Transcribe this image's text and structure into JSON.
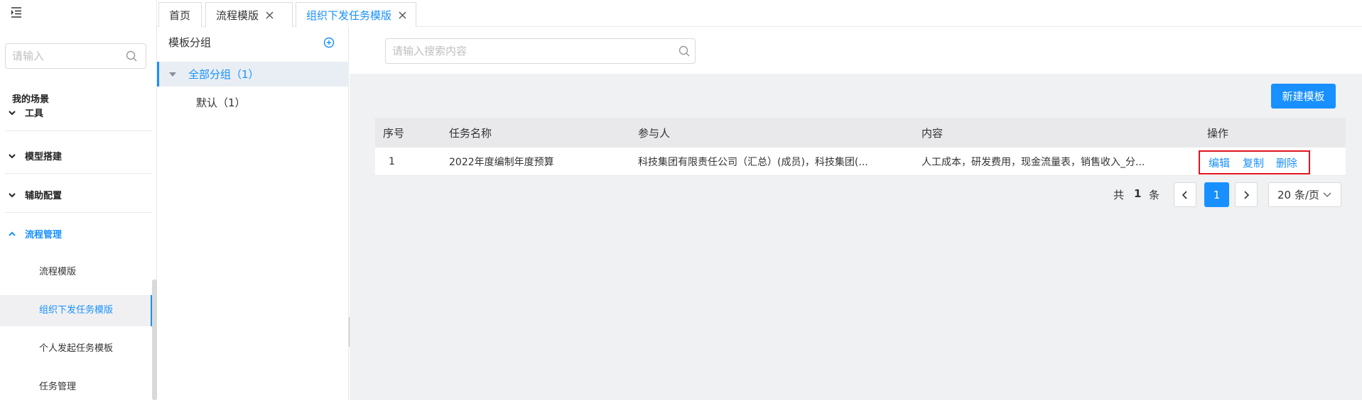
{
  "nav": {
    "search_placeholder": "请输入",
    "section_title": "我的场景",
    "groups": [
      {
        "label": "工具",
        "expanded": false
      },
      {
        "label": "模型搭建",
        "expanded": false
      },
      {
        "label": "辅助配置",
        "expanded": false
      },
      {
        "label": "流程管理",
        "expanded": true
      }
    ],
    "sub_items": [
      {
        "label": "流程模版",
        "active": false
      },
      {
        "label": "组织下发任务模版",
        "active": true
      },
      {
        "label": "个人发起任务模板",
        "active": false
      },
      {
        "label": "任务管理",
        "active": false
      }
    ]
  },
  "tabs": [
    {
      "label": "首页",
      "closable": false,
      "active": false
    },
    {
      "label": "流程模版",
      "closable": true,
      "active": false
    },
    {
      "label": "组织下发任务模版",
      "closable": true,
      "active": true
    }
  ],
  "template_groups": {
    "title": "模板分组",
    "all_group": "全部分组（1）",
    "default_group": "默认（1）"
  },
  "main": {
    "search_placeholder": "请输入搜索内容",
    "new_button": "新建模板",
    "table": {
      "headers": [
        "序号",
        "任务名称",
        "参与人",
        "内容",
        "操作"
      ],
      "rows": [
        {
          "index": "1",
          "name": "2022年度编制年度预算",
          "participants": "科技集团有限责任公司（汇总）(成员)，科技集团(...",
          "content": "人工成本，研发费用，现金流量表，销售收入_分...",
          "actions": [
            "编辑",
            "复制",
            "删除"
          ]
        }
      ]
    },
    "pagination": {
      "total_prefix": "共",
      "total": "1",
      "total_suffix": "条",
      "current_page": "1",
      "page_size": "20 条/页"
    }
  },
  "colors": {
    "accent": "#1890ff",
    "highlight_border": "#e0141e"
  }
}
